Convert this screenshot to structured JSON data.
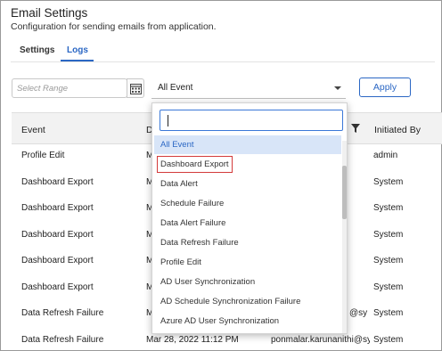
{
  "header": {
    "title": "Email Settings",
    "subtitle": "Configuration for sending emails from application."
  },
  "tabs": [
    {
      "label": "Settings",
      "active": false
    },
    {
      "label": "Logs",
      "active": true
    }
  ],
  "filters": {
    "range_placeholder": "Select Range",
    "event_value": "All Event",
    "apply_label": "Apply"
  },
  "table": {
    "columns": [
      "Event",
      "D",
      "Initiated By"
    ],
    "rows": [
      {
        "event": "Profile Edit",
        "date": "M",
        "to": "",
        "by": "admin"
      },
      {
        "event": "Dashboard Export",
        "date": "M",
        "to": "",
        "by": "System"
      },
      {
        "event": "Dashboard Export",
        "date": "M",
        "to": "",
        "by": "System"
      },
      {
        "event": "Dashboard Export",
        "date": "M",
        "to": "",
        "by": "System"
      },
      {
        "event": "Dashboard Export",
        "date": "M",
        "to": "",
        "by": "System"
      },
      {
        "event": "Dashboard Export",
        "date": "M",
        "to": "",
        "by": "System"
      },
      {
        "event": "Data Refresh Failure",
        "date": "M",
        "to": "@sy",
        "by": "System"
      },
      {
        "event": "Data Refresh Failure",
        "date": "Mar 28, 2022 11:12 PM",
        "to": "ponmalar.karunanithi@sy",
        "by": "System"
      }
    ]
  },
  "dropdown": {
    "search_value": "",
    "options": [
      "All Event",
      "Dashboard Export",
      "Data Alert",
      "Schedule Failure",
      "Data Alert Failure",
      "Data Refresh Failure",
      "Profile Edit",
      "AD User Synchronization",
      "AD Schedule Synchronization Failure",
      "Azure AD User Synchronization"
    ],
    "selected_index": 0,
    "highlighted_index": 1
  },
  "colors": {
    "accent": "#2b67c4",
    "highlight_outline": "#d33a3a",
    "selected_bg": "#d8e5f8"
  }
}
